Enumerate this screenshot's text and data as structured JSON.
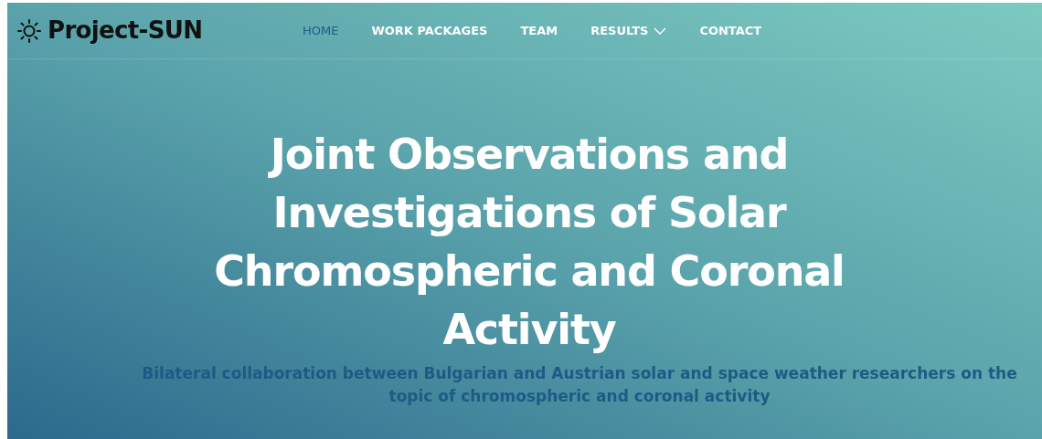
{
  "logo": {
    "text": "Project-SUN"
  },
  "nav": [
    {
      "label": "HOME",
      "selected": true,
      "dropdown": false
    },
    {
      "label": "WORK PACKAGES",
      "selected": false,
      "dropdown": false
    },
    {
      "label": "TEAM",
      "selected": false,
      "dropdown": false
    },
    {
      "label": "RESULTS",
      "selected": false,
      "dropdown": true
    },
    {
      "label": "CONTACT",
      "selected": false,
      "dropdown": false
    }
  ],
  "hero": {
    "title": "Joint Observations and Investigations of Solar Chromospheric and Coronal Activity",
    "subtitle": "Bilateral collaboration between Bulgarian and Austrian solar and space weather researchers on the topic of chromospheric and coronal activity"
  }
}
